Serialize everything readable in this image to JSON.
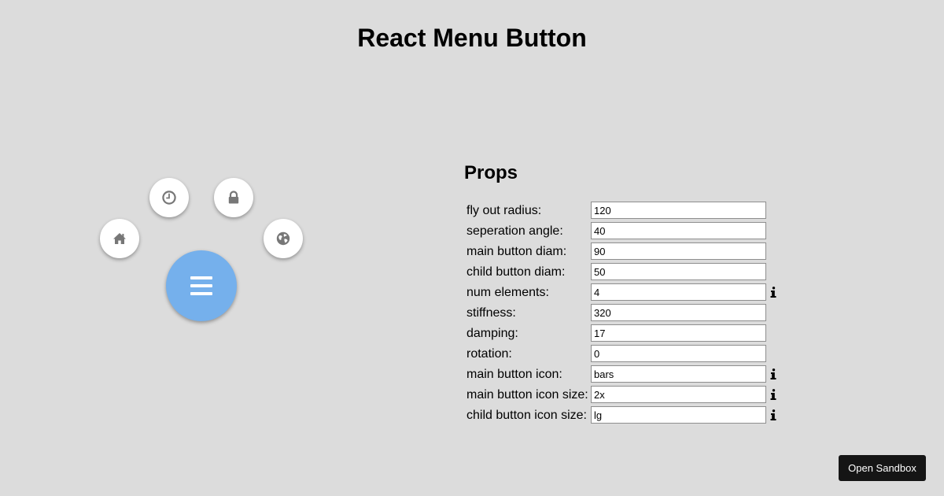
{
  "page": {
    "title": "React Menu Button"
  },
  "menu": {
    "main_button_icon": "bars-icon",
    "main_button_color": "#75b0ec",
    "child_button_color": "#ffffff",
    "child_icon_color": "#777777",
    "children": [
      {
        "icon": "home-icon"
      },
      {
        "icon": "clock-icon"
      },
      {
        "icon": "lock-icon"
      },
      {
        "icon": "globe-icon"
      }
    ]
  },
  "props": {
    "heading": "Props",
    "rows": [
      {
        "label": "fly out radius:",
        "value": "120",
        "info": false
      },
      {
        "label": "seperation angle:",
        "value": "40",
        "info": false
      },
      {
        "label": "main button diam:",
        "value": "90",
        "info": false
      },
      {
        "label": "child button diam:",
        "value": "50",
        "info": false
      },
      {
        "label": "num elements:",
        "value": "4",
        "info": true
      },
      {
        "label": "stiffness:",
        "value": "320",
        "info": false
      },
      {
        "label": "damping:",
        "value": "17",
        "info": false
      },
      {
        "label": "rotation:",
        "value": "0",
        "info": false
      },
      {
        "label": "main button icon:",
        "value": "bars",
        "info": true
      },
      {
        "label": "main button icon size:",
        "value": "2x",
        "info": true
      },
      {
        "label": "child button icon size:",
        "value": "lg",
        "info": true
      }
    ]
  },
  "sandbox": {
    "label": "Open Sandbox"
  }
}
